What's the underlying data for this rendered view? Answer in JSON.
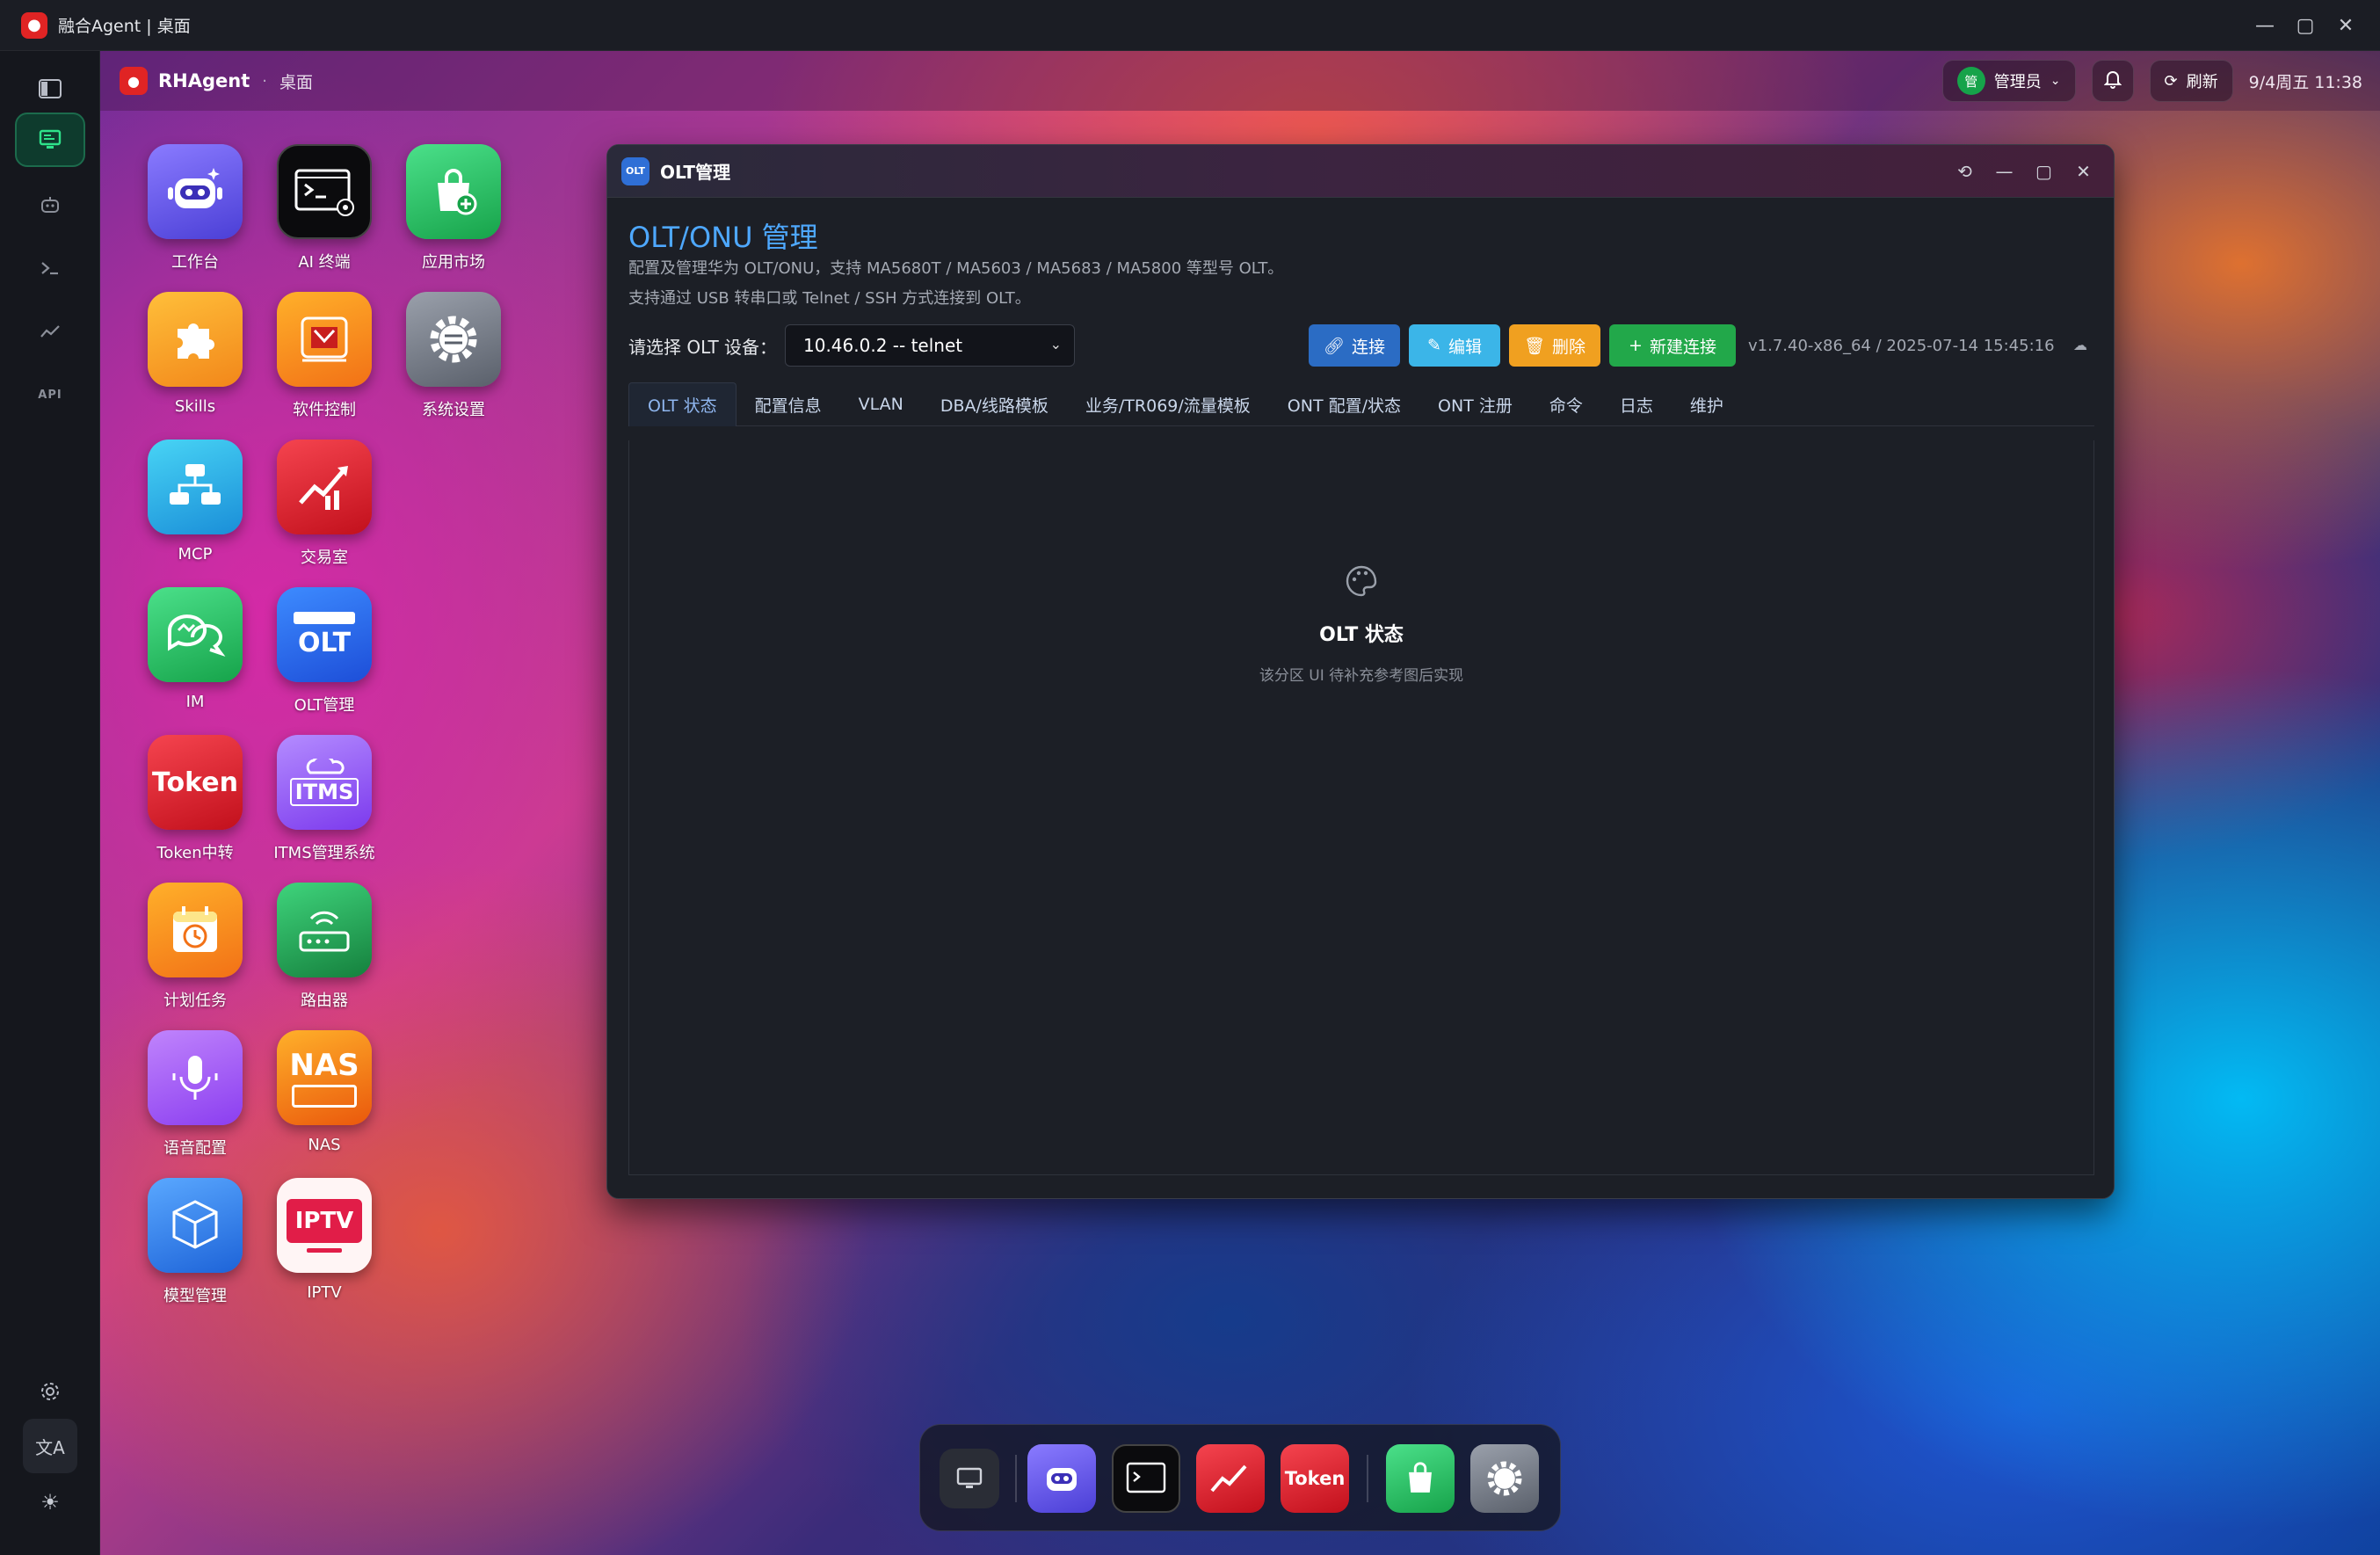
{
  "window_title": "融合Agent | 桌面",
  "header": {
    "brand": "RHAgent",
    "crumb": "桌面",
    "user_badge": "管",
    "user_role": "管理员",
    "refresh_label": "刷新",
    "datetime": "9/4周五 11:38"
  },
  "rail": {
    "items": [
      "desktop-icon",
      "robot-icon",
      "terminal-icon",
      "chart-icon",
      "API"
    ],
    "bottom": [
      "settings-icon",
      "translate-icon",
      "theme-icon"
    ]
  },
  "desktop": {
    "apps": [
      {
        "label": "工作台",
        "icon": "robot-icon",
        "color": "#6d5cf0"
      },
      {
        "label": "AI 终端",
        "icon": "terminal-icon",
        "color": "#111111"
      },
      {
        "label": "应用市场",
        "icon": "shopping-bag-icon",
        "color": "#22c55e"
      },
      {
        "label": "Skills",
        "icon": "puzzle-icon",
        "color": "#f59e0b"
      },
      {
        "label": "软件控制",
        "icon": "chip-icon",
        "color": "#f97316"
      },
      {
        "label": "系统设置",
        "icon": "gear-icon",
        "color": "#6b7280"
      },
      {
        "label": "MCP",
        "icon": "network-icon",
        "color": "#22b8e6"
      },
      {
        "label": "交易室",
        "icon": "trading-chart-icon",
        "color": "#e11d2e"
      },
      {
        "label": "IM",
        "icon": "chat-bubbles-icon",
        "color": "#22c55e"
      },
      {
        "label": "OLT管理",
        "icon": "olt-device-icon",
        "color": "#2563eb"
      },
      {
        "label": "Token中转",
        "icon": "token-icon",
        "color": "#e11d2e"
      },
      {
        "label": "ITMS管理系统",
        "icon": "itms-cloud-icon",
        "color": "#8b5cf6"
      },
      {
        "label": "计划任务",
        "icon": "calendar-clock-icon",
        "color": "#f97316"
      },
      {
        "label": "路由器",
        "icon": "router-icon",
        "color": "#16a34a"
      },
      {
        "label": "语音配置",
        "icon": "microphone-icon",
        "color": "#a855f7"
      },
      {
        "label": "NAS",
        "icon": "nas-icon",
        "color": "#f97316"
      },
      {
        "label": "模型管理",
        "icon": "cube-icon",
        "color": "#3b82f6"
      },
      {
        "label": "IPTV",
        "icon": "iptv-icon",
        "color": "#f43f5e"
      }
    ],
    "tile_text": {
      "token": "Token",
      "token_dock": "Token",
      "olt": "OLT",
      "itms": "ITMS",
      "nas": "NAS",
      "iptv": "IPTV"
    }
  },
  "olt_window": {
    "title": "OLT管理",
    "icon_text": "OLT",
    "heading": "OLT/ONU 管理",
    "desc1": "配置及管理华为 OLT/ONU，支持 MA5680T / MA5603 / MA5683 / MA5800 等型号 OLT。",
    "desc2": "支持通过 USB 转串口或 Telnet / SSH 方式连接到 OLT。",
    "select_label": "请选择 OLT 设备：",
    "select_value": "10.46.0.2 -- telnet",
    "buttons": {
      "connect": "连接",
      "edit": "编辑",
      "delete": "删除",
      "new": "新建连接"
    },
    "version": "v1.7.40-x86_64 / 2025-07-14 15:45:16",
    "tabs": [
      "OLT 状态",
      "配置信息",
      "VLAN",
      "DBA/线路模板",
      "业务/TR069/流量模板",
      "ONT 配置/状态",
      "ONT 注册",
      "命令",
      "日志",
      "维护"
    ],
    "active_tab": "OLT 状态",
    "placeholder_title": "OLT 状态",
    "placeholder_sub": "该分区 UI 待补充参考图后实现"
  },
  "dock": {
    "items": [
      "desktop-icon",
      "robot-icon",
      "terminal-icon",
      "trading-chart-icon",
      "token-icon",
      "shopping-bag-icon",
      "gear-icon"
    ]
  },
  "colors": {
    "accent_blue": "#4ea8ff",
    "connect": "#2b6cc4",
    "edit": "#3bb5e8",
    "delete": "#f0a020",
    "new": "#22a84a"
  }
}
